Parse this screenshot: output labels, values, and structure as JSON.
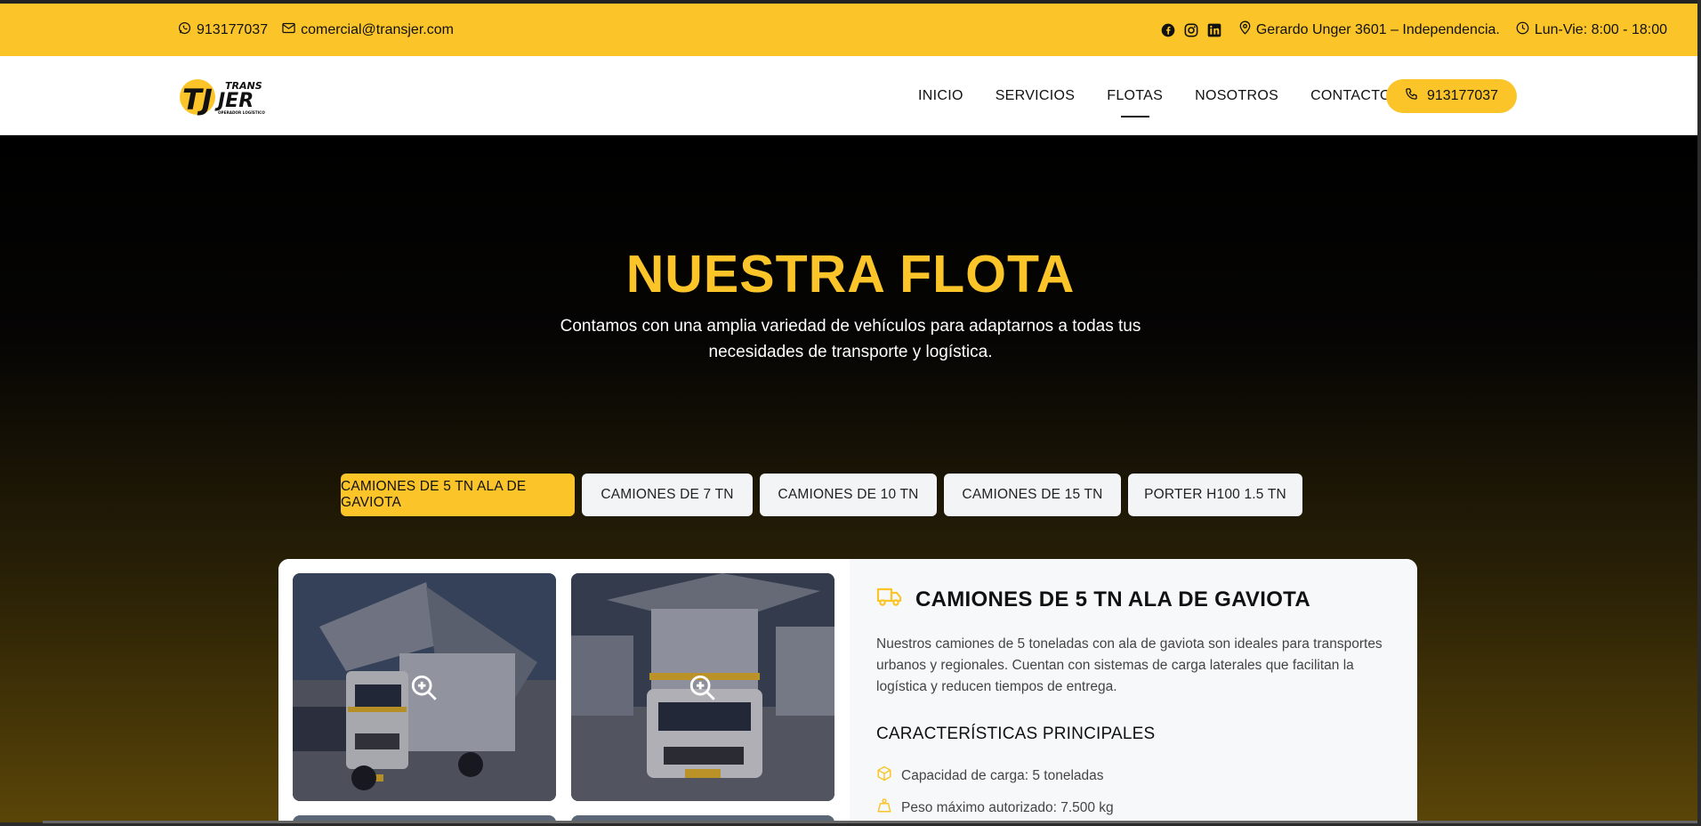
{
  "topbar": {
    "phone": "913177037",
    "email": "comercial@transjer.com",
    "address": "Gerardo Unger 3601 – Independencia.",
    "hours": "Lun-Vie: 8:00 - 18:00",
    "social": [
      "facebook-icon",
      "instagram-icon",
      "linkedin-icon"
    ]
  },
  "brand": {
    "logo_top": "TRANS",
    "logo_main": "JER",
    "logo_tag": "OPERADOR LOGÍSTICO",
    "logo_mark": "TJ"
  },
  "nav": {
    "links": [
      "INICIO",
      "SERVICIOS",
      "FLOTAS",
      "NOSOTROS",
      "CONTACTO"
    ],
    "active": "FLOTAS",
    "call_label": "913177037"
  },
  "hero": {
    "title": "NUESTRA FLOTA",
    "subtitle": "Contamos con una amplia variedad de vehículos para adaptarnos a todas tus necesidades de transporte y logística."
  },
  "tabs": [
    "CAMIONES DE 5 TN ALA DE GAVIOTA",
    "CAMIONES DE 7 TN",
    "CAMIONES DE 10 TN",
    "CAMIONES DE 15 TN",
    "PORTER H100 1.5 TN"
  ],
  "fleet": {
    "title": "CAMIONES DE 5 TN ALA DE GAVIOTA",
    "description": "Nuestros camiones de 5 toneladas con ala de gaviota son ideales para transportes urbanos y regionales. Cuentan con sistemas de carga laterales que facilitan la logística y reducen tiempos de entrega.",
    "features_title": "CARACTERÍSTICAS PRINCIPALES",
    "features": [
      "Capacidad de carga: 5 toneladas",
      "Peso máximo autorizado: 7.500 kg"
    ]
  },
  "colors": {
    "accent": "#fbc52a",
    "dark": "#000000"
  }
}
